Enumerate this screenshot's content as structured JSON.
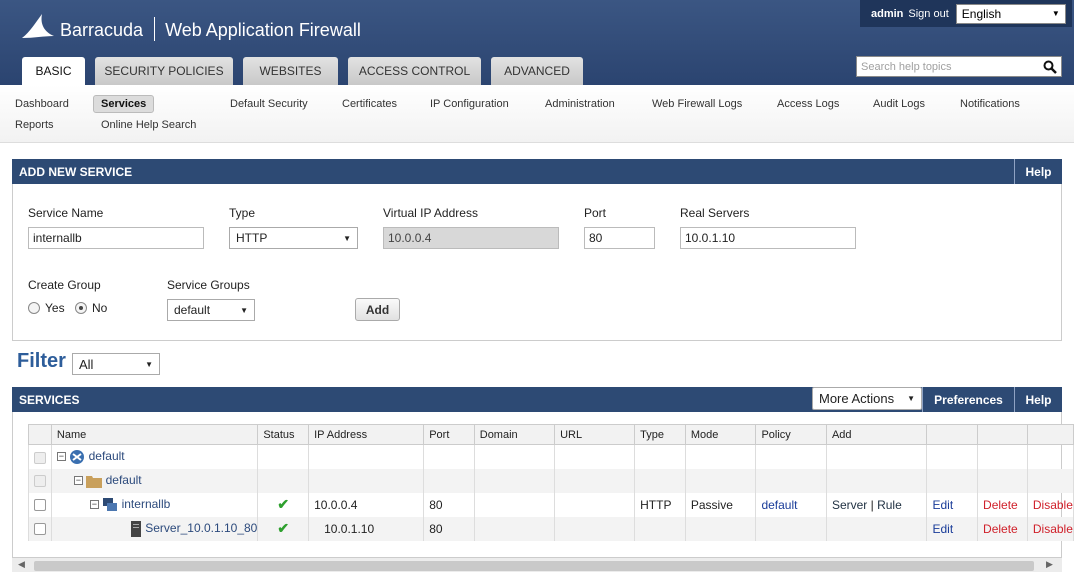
{
  "header": {
    "brand": "Barracuda",
    "product": "Web Application Firewall",
    "user": "admin",
    "signout": "Sign out",
    "language": "English",
    "help_search_placeholder": "Search help topics"
  },
  "tabs": [
    "BASIC",
    "SECURITY POLICIES",
    "WEBSITES",
    "ACCESS CONTROL",
    "ADVANCED"
  ],
  "subnav": {
    "row1": [
      "Dashboard",
      "Services",
      "Default Security",
      "Certificates",
      "IP Configuration",
      "Administration",
      "Web Firewall Logs",
      "Access Logs",
      "Audit Logs",
      "Notifications"
    ],
    "row2": [
      "Reports",
      "Online Help Search"
    ]
  },
  "add_service": {
    "title": "ADD NEW SERVICE",
    "help": "Help",
    "labels": {
      "service_name": "Service Name",
      "type": "Type",
      "vip": "Virtual IP Address",
      "port": "Port",
      "real_servers": "Real Servers",
      "create_group": "Create Group",
      "service_groups": "Service Groups"
    },
    "values": {
      "service_name": "internallb",
      "type": "HTTP",
      "vip": "10.0.0.4",
      "port": "80",
      "real_servers": "10.0.1.10",
      "service_groups": "default"
    },
    "radio_yes": "Yes",
    "radio_no": "No",
    "add_button": "Add"
  },
  "filter": {
    "label": "Filter",
    "value": "All"
  },
  "services": {
    "title": "SERVICES",
    "more_actions": "More Actions",
    "preferences": "Preferences",
    "help": "Help",
    "columns": [
      "Name",
      "Status",
      "IP Address",
      "Port",
      "Domain",
      "URL",
      "Type",
      "Mode",
      "Policy",
      "Add",
      "",
      "",
      ""
    ],
    "rows": [
      {
        "name": "default",
        "status": "",
        "ip": "",
        "port": "",
        "type": "",
        "mode": "",
        "policy": "",
        "add_server": "",
        "add_rule": "",
        "edit": "",
        "delete": "",
        "disable": ""
      },
      {
        "name": "default",
        "status": "",
        "ip": "",
        "port": "",
        "type": "",
        "mode": "",
        "policy": "",
        "add_server": "",
        "add_rule": "",
        "edit": "",
        "delete": "",
        "disable": ""
      },
      {
        "name": "internallb",
        "status": "ok",
        "ip": "10.0.0.4",
        "port": "80",
        "type": "HTTP",
        "mode": "Passive",
        "policy": "default",
        "add_server": "Server",
        "add_rule": "Rule",
        "edit": "Edit",
        "delete": "Delete",
        "disable": "Disable"
      },
      {
        "name": "Server_10.0.1.10_80",
        "status": "ok",
        "ip": "10.0.1.10",
        "port": "80",
        "type": "",
        "mode": "",
        "policy": "",
        "add_server": "",
        "add_rule": "",
        "edit": "Edit",
        "delete": "Delete",
        "disable": "Disable"
      }
    ],
    "separator": "|"
  },
  "colors": {
    "header_bg": "#2b4470",
    "panel_bar": "#2d4a74",
    "filter_text": "#2d5d9a",
    "delete_red": "#d0202a",
    "edit_blue": "#1a3c99",
    "status_green": "#2ea02e"
  }
}
